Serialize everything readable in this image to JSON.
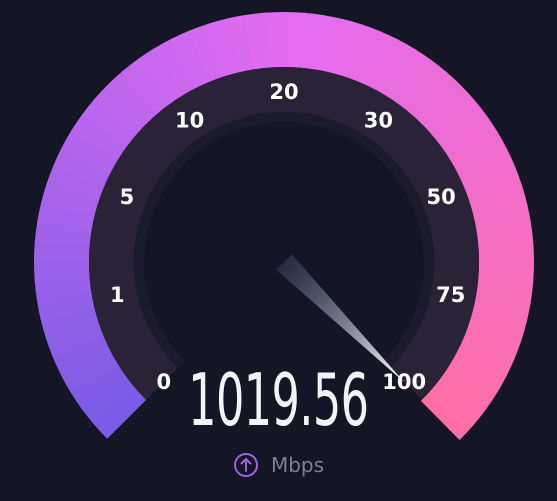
{
  "gauge": {
    "ticks": [
      "0",
      "1",
      "5",
      "10",
      "20",
      "30",
      "50",
      "75",
      "100"
    ],
    "scale_max_label": "100",
    "needle_value": 100
  },
  "readout": {
    "speed": "1019.56",
    "unit": "Mbps",
    "direction_icon": "upload-arrow-icon"
  },
  "colors": {
    "background": "#141625",
    "arc_start": "#7a5ce6",
    "arc_mid": "#e36cf2",
    "arc_end": "#ff6fa6",
    "unit_accent": "#a35fe0"
  }
}
